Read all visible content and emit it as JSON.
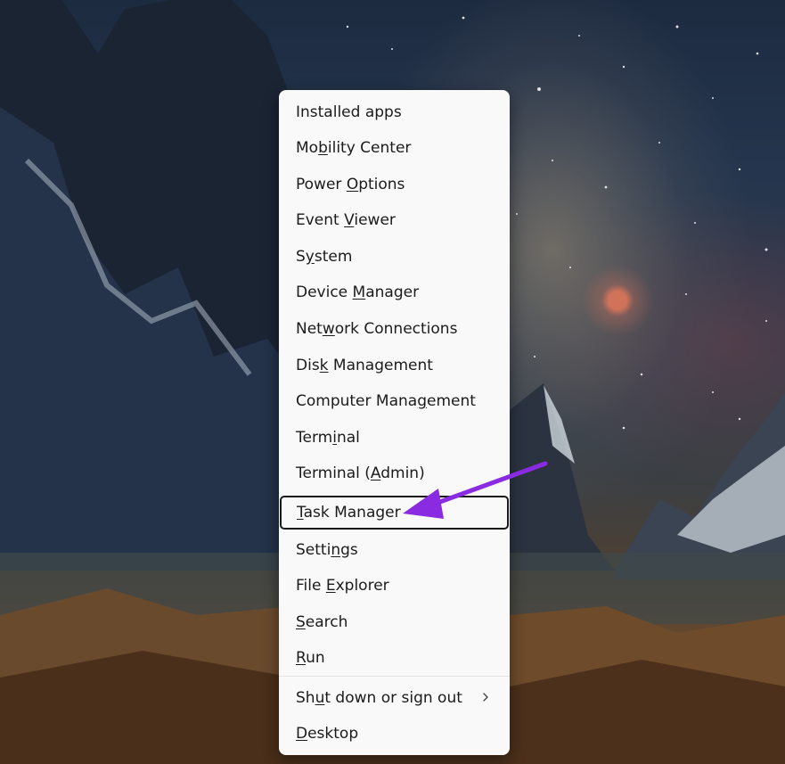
{
  "context_menu": {
    "items": [
      {
        "pre": "Installed apps",
        "accel": "",
        "post": ""
      },
      {
        "pre": "Mo",
        "accel": "b",
        "post": "ility Center"
      },
      {
        "pre": "Power ",
        "accel": "O",
        "post": "ptions"
      },
      {
        "pre": "Event ",
        "accel": "V",
        "post": "iewer"
      },
      {
        "pre": "S",
        "accel": "y",
        "post": "stem"
      },
      {
        "pre": "Device ",
        "accel": "M",
        "post": "anager"
      },
      {
        "pre": "Net",
        "accel": "w",
        "post": "ork Connections"
      },
      {
        "pre": "Dis",
        "accel": "k",
        "post": " Management"
      },
      {
        "pre": "Computer Mana",
        "accel": "g",
        "post": "ement"
      },
      {
        "pre": "Term",
        "accel": "i",
        "post": "nal"
      },
      {
        "pre": "Terminal (",
        "accel": "A",
        "post": "dmin)"
      },
      {
        "pre": "",
        "accel": "T",
        "post": "ask Manager"
      },
      {
        "pre": "Setti",
        "accel": "n",
        "post": "gs"
      },
      {
        "pre": "File ",
        "accel": "E",
        "post": "xplorer"
      },
      {
        "pre": "",
        "accel": "S",
        "post": "earch"
      },
      {
        "pre": "",
        "accel": "R",
        "post": "un"
      },
      {
        "pre": "Sh",
        "accel": "u",
        "post": "t down or sign out"
      },
      {
        "pre": "",
        "accel": "D",
        "post": "esktop"
      }
    ],
    "focused_index": 11,
    "submenu_index": 16,
    "submenu_icon": "chevron-right-icon"
  },
  "annotation": {
    "icon": "arrow-pointer-icon",
    "color": "#8a2be2"
  },
  "colors": {
    "menu_bg": "#f9f9f9",
    "text": "#1b1b1b",
    "focus_border": "#1a1a1a"
  }
}
